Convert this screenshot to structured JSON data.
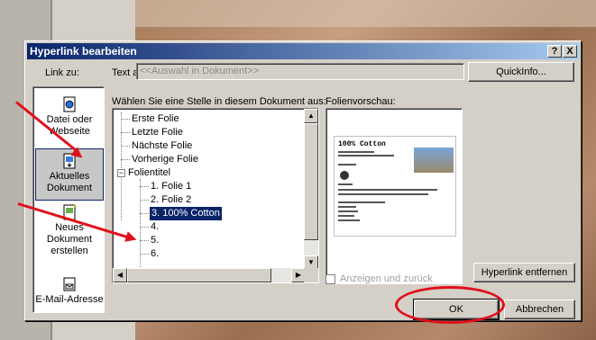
{
  "dialog": {
    "title": "Hyperlink bearbeiten",
    "help_btn": "?",
    "close_btn": "X",
    "link_to_label": "Link zu:",
    "text_label": "Text anzeigen als:",
    "text_value": "<<Auswahl in Dokument>>",
    "quickinfo_btn": "QuickInfo...",
    "choose_label": "Wählen Sie eine Stelle in diesem Dokument aus:",
    "preview_label": "Folienvorschau:",
    "show_and_back_label": "Anzeigen und zurück",
    "remove_link_btn": "Hyperlink entfernen",
    "ok_btn": "OK",
    "cancel_btn": "Abbrechen"
  },
  "link_targets": [
    {
      "line1": "Datei oder",
      "line2": "Webseite",
      "icon": "file-web-icon"
    },
    {
      "line1": "Aktuelles",
      "line2": "Dokument",
      "icon": "current-document-icon"
    },
    {
      "line1": "Neues",
      "line2": "Dokument",
      "line3": "erstellen",
      "icon": "new-document-icon"
    },
    {
      "line1": "E-Mail-Adresse",
      "icon": "email-icon"
    }
  ],
  "tree": [
    "Erste Folie",
    "Letzte Folie",
    "Nächste Folie",
    "Vorherige Folie",
    "Folientitel",
    "1. Folie 1",
    "2. Folie 2",
    "3. 100% Cotton",
    "4.",
    "5.",
    "6."
  ],
  "preview": {
    "slide_title": "100% Cotton"
  },
  "colors": {
    "title_bar": "#0a246a",
    "annotation": "#e0101a"
  }
}
